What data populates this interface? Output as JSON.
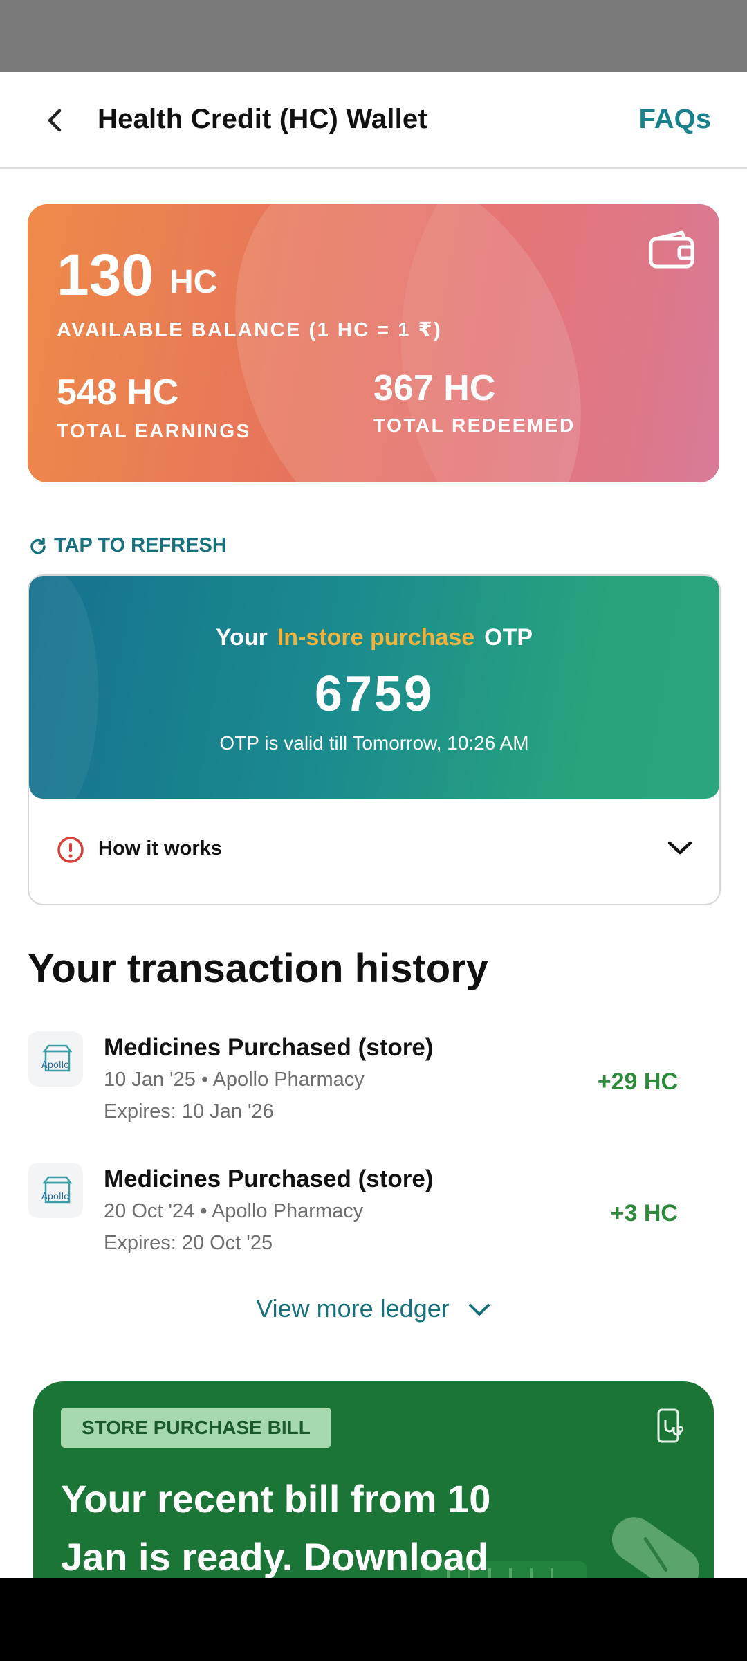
{
  "header": {
    "title": "Health Credit (HC) Wallet",
    "faq_label": "FAQs"
  },
  "balance_card": {
    "available": "130",
    "unit": "HC",
    "available_label": "AVAILABLE BALANCE (1 HC = 1 ₹)",
    "total_earnings": "548 HC",
    "total_earnings_label": "TOTAL EARNINGS",
    "total_redeemed": "367 HC",
    "total_redeemed_label": "TOTAL REDEEMED"
  },
  "refresh_label": "TAP TO REFRESH",
  "otp": {
    "prefix": "Your",
    "highlight": "In-store purchase",
    "suffix": "OTP",
    "code": "6759",
    "validity": "OTP is valid till Tomorrow, 10:26 AM",
    "how_it_works": "How it works",
    "highlight_color": "#f3b23b"
  },
  "history": {
    "title": "Your transaction history",
    "items": [
      {
        "title": "Medicines Purchased (store)",
        "meta": "10 Jan '25 • Apollo Pharmacy",
        "expires": "Expires: 10 Jan '26",
        "amount": "+29 HC"
      },
      {
        "title": "Medicines Purchased (store)",
        "meta": "20 Oct '24 • Apollo Pharmacy",
        "expires": "Expires: 20 Oct '25",
        "amount": "+3 HC"
      }
    ],
    "logo_text": "Apollo",
    "view_more": "View more ledger"
  },
  "promo": {
    "tag": "STORE PURCHASE BILL",
    "text": "Your recent bill from 10 Jan is ready. Download"
  },
  "colors": {
    "accent": "#17828e",
    "credit": "#2e8b3c",
    "promo_bg": "#1b7536"
  }
}
